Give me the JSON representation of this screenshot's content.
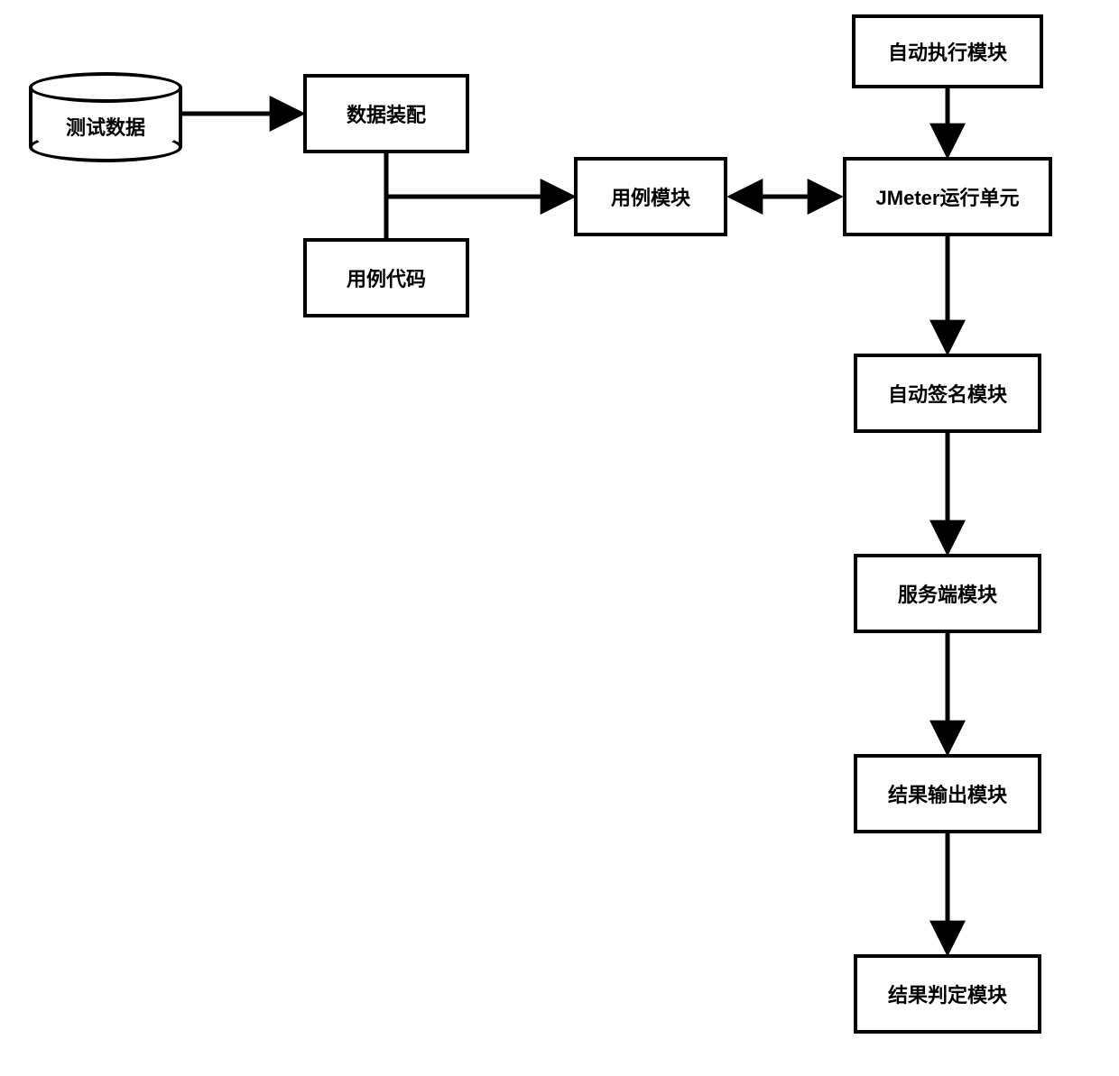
{
  "nodes": {
    "test_data": "测试数据",
    "data_assembly": "数据装配",
    "use_case_code": "用例代码",
    "use_case_module": "用例模块",
    "auto_exec_module": "自动执行模块",
    "jmeter_unit": "JMeter运行单元",
    "auto_sign_module": "自动签名模块",
    "server_module": "服务端模块",
    "result_output_module": "结果输出模块",
    "result_judge_module": "结果判定模块"
  }
}
